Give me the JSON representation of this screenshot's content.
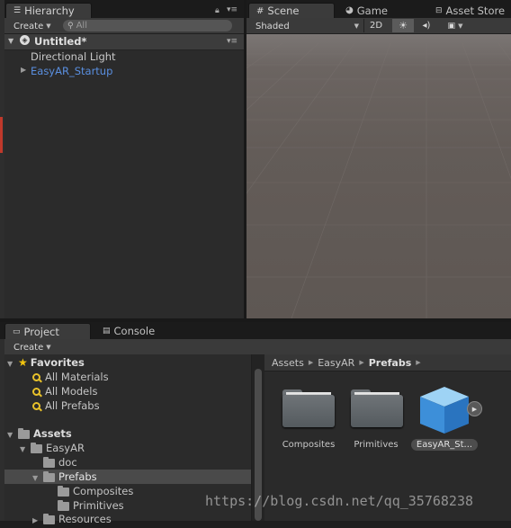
{
  "hierarchy": {
    "tab_label": "Hierarchy",
    "create_label": "Create",
    "search_placeholder": "All",
    "scene_name": "Untitled*",
    "items": [
      {
        "label": "Directional Light"
      },
      {
        "label": "EasyAR_Startup"
      }
    ]
  },
  "scene_tabs": {
    "scene": "Scene",
    "game": "Game",
    "asset_store": "Asset Store"
  },
  "scene_toolbar": {
    "shading_mode": "Shaded",
    "mode_2d": "2D"
  },
  "bottom_tabs": {
    "project": "Project",
    "console": "Console"
  },
  "project": {
    "create_label": "Create",
    "favorites": {
      "label": "Favorites",
      "items": [
        "All Materials",
        "All Models",
        "All Prefabs"
      ]
    },
    "assets_label": "Assets",
    "tree": {
      "easyar": "EasyAR",
      "doc": "doc",
      "prefabs": "Prefabs",
      "composites": "Composites",
      "primitives": "Primitives",
      "resources": "Resources"
    },
    "breadcrumb": [
      "Assets",
      "EasyAR",
      "Prefabs"
    ],
    "assets": [
      {
        "label": "Composites",
        "type": "folder"
      },
      {
        "label": "Primitives",
        "type": "folder"
      },
      {
        "label": "EasyAR_St...",
        "type": "prefab"
      }
    ]
  },
  "watermark": "https://blog.csdn.net/qq_35768238",
  "colors": {
    "link_blue": "#5a8fe0",
    "selected_row": "#4a4a4a",
    "scene_bg": "#635c58"
  }
}
